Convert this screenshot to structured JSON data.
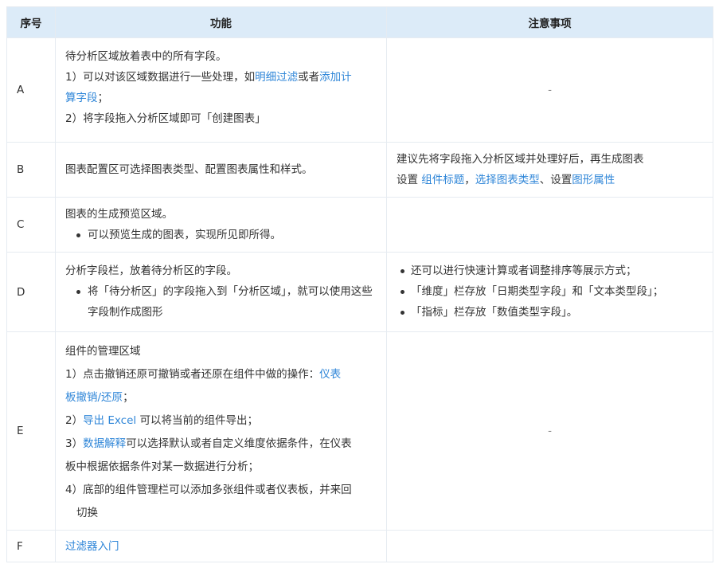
{
  "headers": {
    "code": "序号",
    "function": "功能",
    "notes": "注意事项"
  },
  "rows": {
    "a": {
      "code": "A",
      "line1": "待分析区域放着表中的所有字段。",
      "item1_prefix": "1）可以对该区域数据进行一些处理，如",
      "item1_link1": "明细过滤",
      "item1_mid": "或者",
      "item1_link2": "添加计",
      "item1_link3": "算字段",
      "item1_end": "；",
      "item2": "2）将字段拖入分析区域即可「创建图表」",
      "note": "-"
    },
    "b": {
      "code": "B",
      "func": "图表配置区可选择图表类型、配置图表属性和样式。",
      "note_line1": "建议先将字段拖入分析区域并处理好后，再生成图表",
      "note_prefix": "设置 ",
      "note_link1": "组件标题",
      "note_sep": "，",
      "note_link2": "选择图表类型",
      "note_mid": "、设置",
      "note_link3": "图形属性"
    },
    "c": {
      "code": "C",
      "line1": "图表的生成预览区域。",
      "bullet": "可以预览生成的图表，实现所见即所得。",
      "note": ""
    },
    "d": {
      "code": "D",
      "line1": "分析字段栏，放着待分析区的字段。",
      "bullet": "将「待分析区」的字段拖入到「分析区域」，就可以使用这些字段制作成图形",
      "notes": [
        "还可以进行快速计算或者调整排序等展示方式；",
        "「维度」栏存放「日期类型字段」和「文本类型段」；",
        "「指标」栏存放「数值类型字段」。"
      ]
    },
    "e": {
      "code": "E",
      "line1": "组件的管理区域",
      "item1_prefix": "1）点击撤销还原可撤销或者还原在组件中做的操作：",
      "item1_link1": "仪表",
      "item1_link2": "板撤销/还原",
      "item1_end": "；",
      "item2_prefix": "2）",
      "item2_link": "导出 Excel",
      "item2_end": " 可以将当前的组件导出；",
      "item3_prefix": "3）",
      "item3_link": "数据解释",
      "item3_a": "可以选择默认或者自定义维度依据条件，在仪表",
      "item3_b": "板中根据依据条件对某一数据进行分析；",
      "item4_a": "4）底部的组件管理栏可以添加多张组件或者仪表板，并来回",
      "item4_b": "切换",
      "note": "-"
    },
    "f": {
      "code": "F",
      "link": "过滤器入门",
      "note": ""
    }
  }
}
